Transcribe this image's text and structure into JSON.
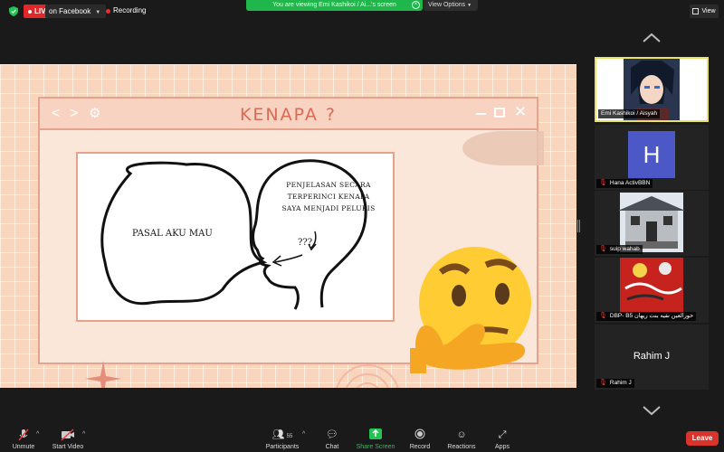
{
  "topbar": {
    "live_badge": "LIVE",
    "stream_target": "on Facebook",
    "recording": "Recording",
    "viewing_banner": "You are viewing Emi Kashikoi / Ai...'s screen",
    "view_options": "View Options",
    "view_button": "View"
  },
  "slide": {
    "title": "KENAPA ?",
    "bubble_text": "PASAL AKU MAU",
    "explanation": "PENJELASAN SECARA TERPERINCI KENAPA SAYA MENJADI PELUKIS",
    "question_marks": "???"
  },
  "participants": [
    {
      "name": "Emi Kashikoi / Aisyah",
      "muted": false,
      "active": true
    },
    {
      "name": "Hana ActivBBN",
      "muted": true,
      "avatar_letter": "H",
      "avatar_color": "#4c58c6"
    },
    {
      "name": "suip wahab",
      "muted": true
    },
    {
      "name": "DBP- B5 حورالعين نفيه بنت ريهان",
      "muted": true
    },
    {
      "name": "Rahim J",
      "muted": true,
      "display_name": "Rahim J"
    }
  ],
  "toolbar": {
    "unmute": "Unmute",
    "start_video": "Start Video",
    "participants": "Participants",
    "participants_count": "55",
    "chat": "Chat",
    "share_screen": "Share Screen",
    "record": "Record",
    "reactions": "Reactions",
    "apps": "Apps",
    "leave": "Leave"
  },
  "colors": {
    "live_red": "#e02828",
    "banner_green": "#1fb64c",
    "active_border": "#e8e26a",
    "leave_red": "#d9342b",
    "slide_title": "#d86b54"
  }
}
